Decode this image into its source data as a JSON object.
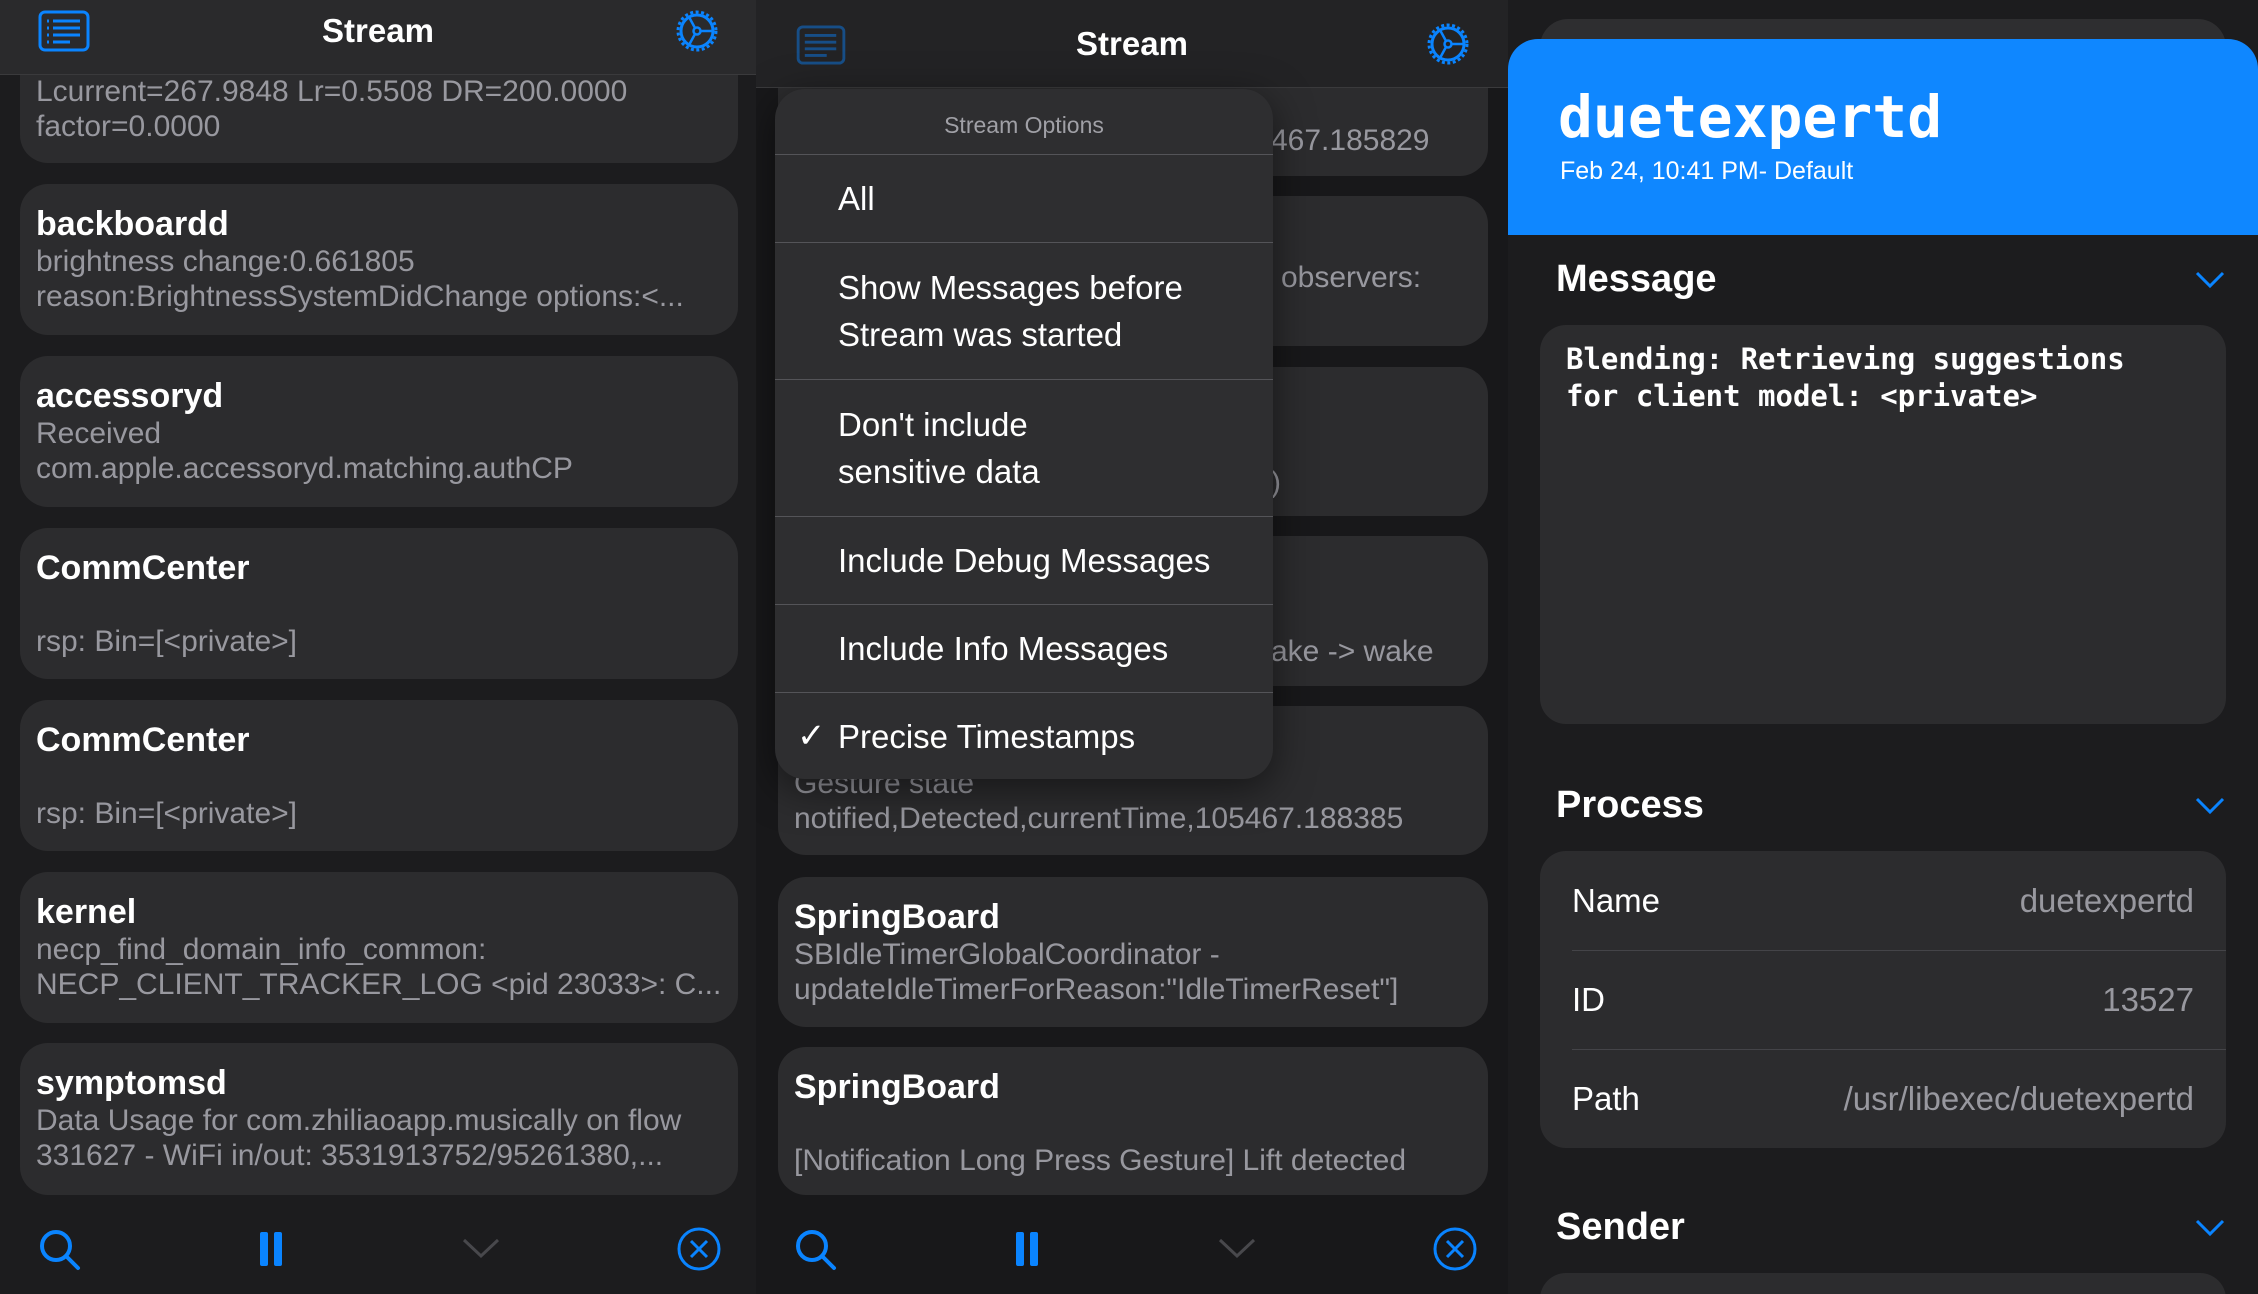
{
  "left_panel": {
    "nav": {
      "title": "Stream",
      "left_icon": "list-icon",
      "right_icon": "gear-icon"
    },
    "cards": [
      {
        "title": "",
        "body": "Lcurrent=267.9848 Lr=0.5508 DR=200.0000\nfactor=0.0000",
        "gap": false
      },
      {
        "title": "backboardd",
        "body": "brightness change:0.661805\nreason:BrightnessSystemDidChange options:<...",
        "gap": false
      },
      {
        "title": "accessoryd",
        "body": "Received\ncom.apple.accessoryd.matching.authCP",
        "gap": false
      },
      {
        "title": "CommCenter",
        "body": "rsp: Bin=[<private>]",
        "gap": true
      },
      {
        "title": "CommCenter",
        "body": "rsp: Bin=[<private>]",
        "gap": true
      },
      {
        "title": "kernel",
        "body": "necp_find_domain_info_common:\nNECP_CLIENT_TRACKER_LOG <pid 23033>: C...",
        "gap": false
      },
      {
        "title": "symptomsd",
        "body": "Data Usage for com.zhiliaoapp.musically on flow\n331627 - WiFi in/out: 3531913752/95261380,...",
        "gap": false
      }
    ],
    "toolbar": [
      "search-icon",
      "pause-icon",
      "chevron-down-icon",
      "close-circle-icon"
    ]
  },
  "middle_panel": {
    "nav": {
      "title": "Stream",
      "left_icon": "list-icon",
      "right_icon": "gear-icon"
    },
    "partial_texts": [
      "467.185829",
      "observers:",
      ")",
      "ake -> wake"
    ],
    "cards": [
      {
        "title": "",
        "body": "Gesture state\nnotified,Detected,currentTime,105467.188385",
        "gap": false
      },
      {
        "title": "SpringBoard",
        "body": "SBIdleTimerGlobalCoordinator -\nupdateIdleTimerForReason:\"IdleTimerReset\"]",
        "gap": false
      },
      {
        "title": "SpringBoard",
        "body": "[Notification Long Press Gesture] Lift detected",
        "gap": true
      }
    ],
    "menu": {
      "header": "Stream Options",
      "items": [
        {
          "label": "All",
          "checked": false
        },
        {
          "label": "Show Messages before\nStream was started",
          "checked": false
        },
        {
          "label": "Don't include\nsensitive data",
          "checked": false
        },
        {
          "label": "Include Debug Messages",
          "checked": false
        },
        {
          "label": "Include Info Messages",
          "checked": false
        },
        {
          "label": "Precise Timestamps",
          "checked": true
        }
      ],
      "check_glyph": "✓"
    },
    "toolbar": [
      "search-icon",
      "pause-icon",
      "chevron-down-icon",
      "close-circle-icon"
    ]
  },
  "detail_panel": {
    "title": "duetexpertd",
    "subtitle": "Feb 24, 10:41 PM- Default",
    "accent": "#0f87ff",
    "message": {
      "heading": "Message",
      "text": "Blending: Retrieving suggestions\nfor client model: <private>"
    },
    "process": {
      "heading": "Process",
      "rows": [
        {
          "label": "Name",
          "value": "duetexpertd"
        },
        {
          "label": "ID",
          "value": "13527"
        },
        {
          "label": "Path",
          "value": "/usr/libexec/duetexpertd"
        }
      ]
    },
    "sender": {
      "heading": "Sender"
    }
  },
  "colors": {
    "blue": "#0a84ff",
    "background": "#1c1c1e",
    "card": "#2c2c2e",
    "secondary_text": "#98989f"
  }
}
